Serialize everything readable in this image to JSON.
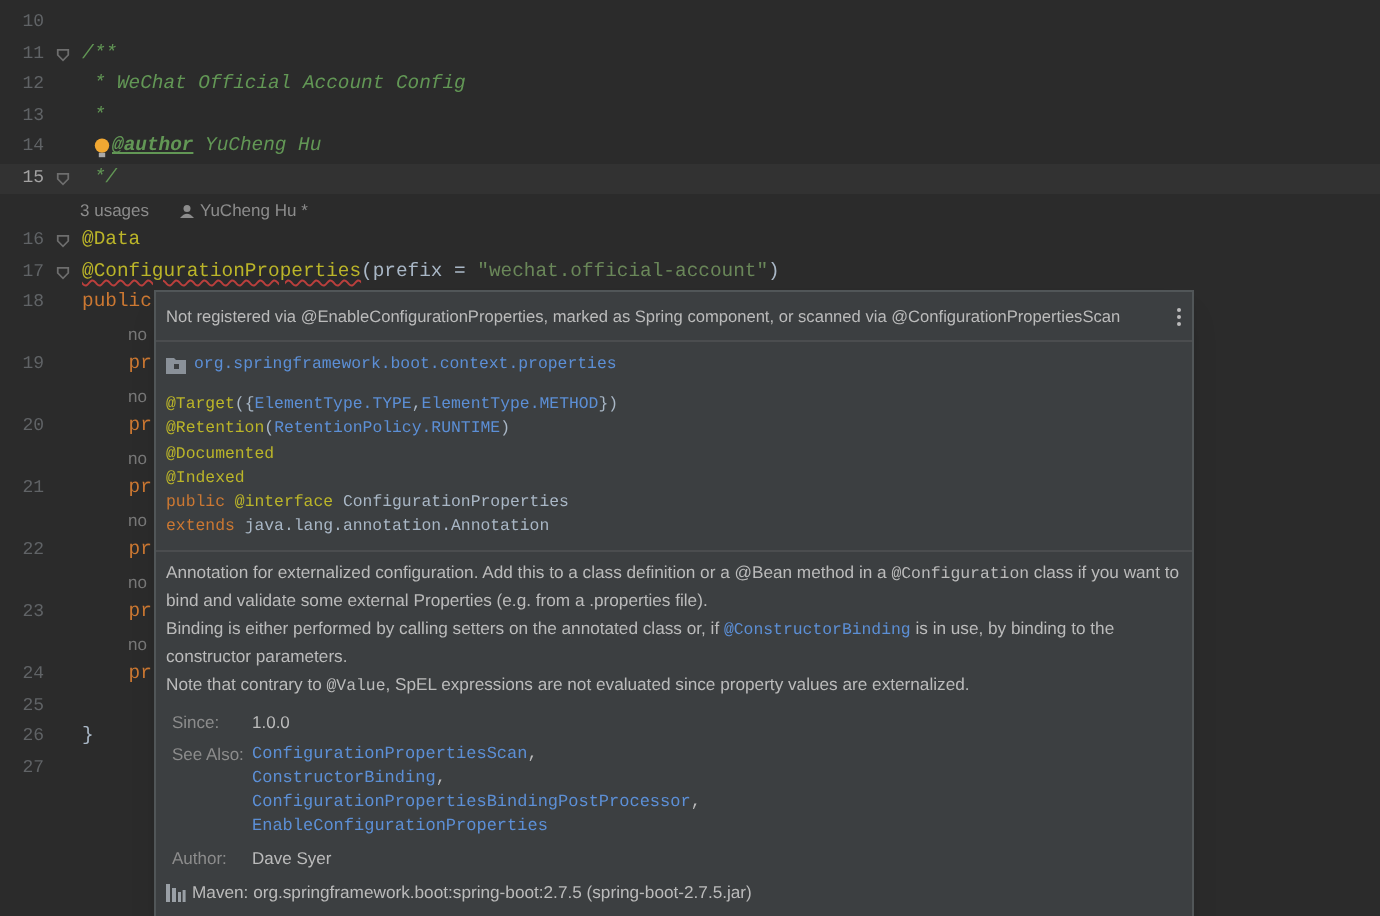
{
  "editor": {
    "rows": [
      {
        "kind": "code",
        "number": "10",
        "current": false,
        "tokens": []
      },
      {
        "kind": "code",
        "number": "11",
        "current": false,
        "fold": true,
        "tokens": [
          {
            "text": "/**",
            "kind": "doc"
          }
        ]
      },
      {
        "kind": "code",
        "number": "12",
        "current": false,
        "tokens": [
          {
            "text": " * WeChat Official Account Config",
            "kind": "doc"
          }
        ]
      },
      {
        "kind": "code",
        "number": "13",
        "current": false,
        "tokens": [
          {
            "text": " *",
            "kind": "doc"
          }
        ]
      },
      {
        "kind": "code",
        "number": "14",
        "current": false,
        "bulb": true,
        "tokens": [
          {
            "text": "@author",
            "kind": "doctag"
          },
          {
            "text": " YuCheng Hu",
            "kind": "doc"
          }
        ]
      },
      {
        "kind": "code",
        "number": "15",
        "current": true,
        "fold": true,
        "tokens": [
          {
            "text": " */",
            "kind": "doc"
          }
        ]
      },
      {
        "kind": "hint",
        "usages": "3 usages",
        "author": "YuCheng Hu *"
      },
      {
        "kind": "code",
        "number": "16",
        "current": false,
        "fold": true,
        "tokens": [
          {
            "text": "@Data",
            "kind": "annotation"
          }
        ]
      },
      {
        "kind": "code",
        "number": "17",
        "current": false,
        "fold": true,
        "tokens": [
          {
            "text": "@ConfigurationProperties",
            "kind": "annotation_error"
          },
          {
            "text": "(prefix = ",
            "kind": "plain"
          },
          {
            "text": "\"wechat.official-account\"",
            "kind": "string"
          },
          {
            "text": ")",
            "kind": "plain"
          }
        ]
      },
      {
        "kind": "code",
        "number": "18",
        "current": false,
        "tokens": [
          {
            "text": "public",
            "kind": "keyword"
          }
        ]
      },
      {
        "kind": "inlay",
        "text": "no"
      },
      {
        "kind": "code",
        "number": "19",
        "current": false,
        "tokens": [
          {
            "text": "    pr",
            "kind": "keyword"
          }
        ]
      },
      {
        "kind": "inlay",
        "text": "no"
      },
      {
        "kind": "code",
        "number": "20",
        "current": false,
        "tokens": [
          {
            "text": "    pr",
            "kind": "keyword"
          }
        ]
      },
      {
        "kind": "inlay",
        "text": "no"
      },
      {
        "kind": "code",
        "number": "21",
        "current": false,
        "tokens": [
          {
            "text": "    pr",
            "kind": "keyword"
          }
        ]
      },
      {
        "kind": "inlay",
        "text": "no"
      },
      {
        "kind": "code",
        "number": "22",
        "current": false,
        "tokens": [
          {
            "text": "    pr",
            "kind": "keyword"
          }
        ]
      },
      {
        "kind": "inlay",
        "text": "no"
      },
      {
        "kind": "code",
        "number": "23",
        "current": false,
        "tokens": [
          {
            "text": "    pr",
            "kind": "keyword"
          }
        ]
      },
      {
        "kind": "inlay",
        "text": "no"
      },
      {
        "kind": "code",
        "number": "24",
        "current": false,
        "tokens": [
          {
            "text": "    pr",
            "kind": "keyword"
          }
        ]
      },
      {
        "kind": "code",
        "number": "25",
        "current": false,
        "tokens": []
      },
      {
        "kind": "code",
        "number": "26",
        "current": false,
        "tokens": [
          {
            "text": "}",
            "kind": "plain"
          }
        ]
      },
      {
        "kind": "code",
        "number": "27",
        "current": false,
        "tokens": []
      }
    ]
  },
  "popup": {
    "warning": "Not registered via @EnableConfigurationProperties, marked as Spring component, or scanned via @ConfigurationPropertiesScan",
    "package": "org.springframework.boot.context.properties",
    "declaration": [
      [
        {
          "text": "@Target",
          "kind": "annotation"
        },
        {
          "text": "({",
          "kind": "plain"
        },
        {
          "text": "ElementType.TYPE",
          "kind": "link"
        },
        {
          "text": ",",
          "kind": "plain"
        },
        {
          "text": "ElementType.METHOD",
          "kind": "link"
        },
        {
          "text": "})",
          "kind": "plain"
        }
      ],
      [
        {
          "text": "@Retention",
          "kind": "annotation"
        },
        {
          "text": "(",
          "kind": "plain"
        },
        {
          "text": "RetentionPolicy.RUNTIME",
          "kind": "link"
        },
        {
          "text": ")",
          "kind": "plain"
        }
      ],
      [
        {
          "text": "@Documented",
          "kind": "annotation"
        }
      ],
      [
        {
          "text": "@Indexed",
          "kind": "annotation"
        }
      ],
      [
        {
          "text": "public ",
          "kind": "keyword"
        },
        {
          "text": "@interface ",
          "kind": "annotation"
        },
        {
          "text": "ConfigurationProperties",
          "kind": "plain"
        }
      ],
      [
        {
          "text": "extends ",
          "kind": "keyword"
        },
        {
          "text": "java.lang.annotation.Annotation",
          "kind": "plain"
        }
      ]
    ],
    "paragraphs": [
      [
        {
          "text": "Annotation for externalized configuration. Add this to a class definition or a @Bean method in a ",
          "kind": "text"
        },
        {
          "text": "@Configuration",
          "kind": "code"
        },
        {
          "text": " class if you want to bind and validate some external Properties (e.g. from a .properties file).",
          "kind": "text"
        }
      ],
      [
        {
          "text": "Binding is either performed by calling setters on the annotated class or, if ",
          "kind": "text"
        },
        {
          "text": "@ConstructorBinding",
          "kind": "link"
        },
        {
          "text": " is in use, by binding to the constructor parameters.",
          "kind": "text"
        }
      ],
      [
        {
          "text": "Note that contrary to ",
          "kind": "text"
        },
        {
          "text": "@Value",
          "kind": "code"
        },
        {
          "text": ", SpEL expressions are not evaluated since property values are externalized.",
          "kind": "text"
        }
      ]
    ],
    "details": [
      {
        "label": "Since:",
        "values": [
          {
            "text": "1.0.0",
            "kind": "text"
          }
        ]
      },
      {
        "label": "See Also:",
        "values": [
          {
            "text": "ConfigurationPropertiesScan",
            "kind": "link",
            "sep": ","
          },
          {
            "text": "ConstructorBinding",
            "kind": "link",
            "sep": ","
          },
          {
            "text": "ConfigurationPropertiesBindingPostProcessor",
            "kind": "link",
            "sep": ","
          },
          {
            "text": "EnableConfigurationProperties",
            "kind": "link"
          }
        ]
      },
      {
        "label": "Author:",
        "values": [
          {
            "text": "Dave Syer",
            "kind": "text"
          }
        ]
      }
    ],
    "source": "Maven: org.springframework.boot:spring-boot:2.7.5 (spring-boot-2.7.5.jar)"
  }
}
